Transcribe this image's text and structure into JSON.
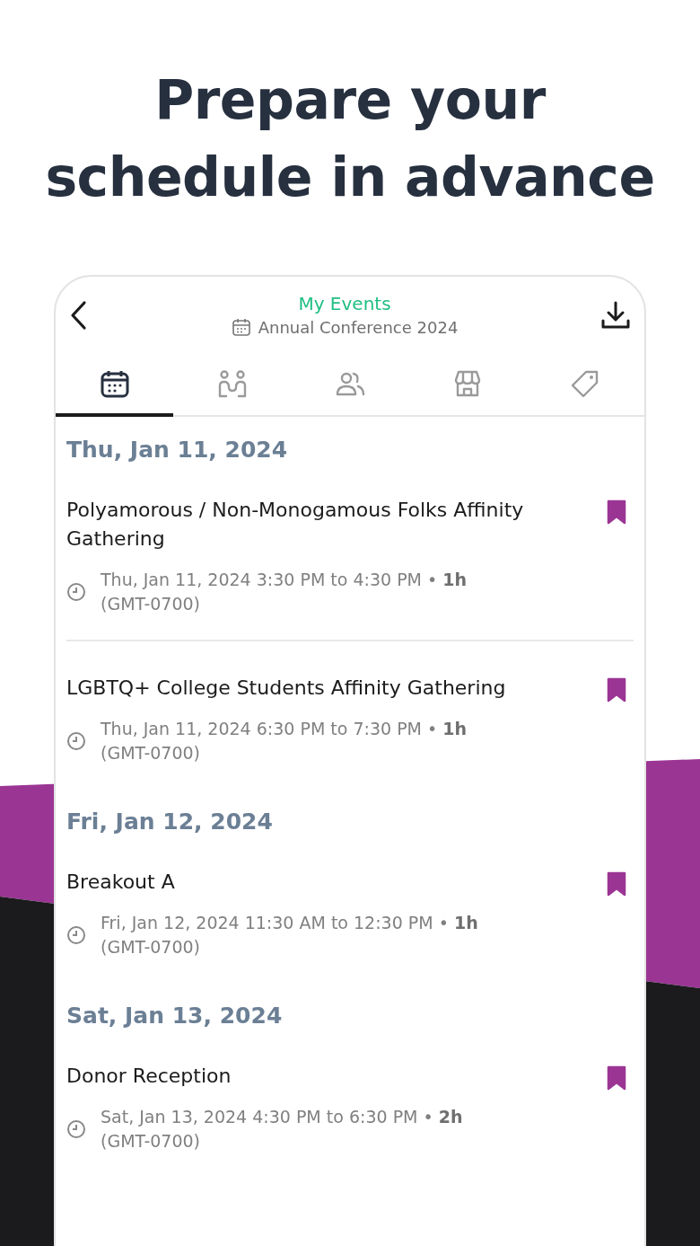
{
  "headline": "Prepare your schedule in advance",
  "header": {
    "title": "My Events",
    "subtitle": "Annual Conference 2024"
  },
  "tabs": [
    {
      "kind": "calendar",
      "selected": true
    },
    {
      "kind": "meetings",
      "selected": false
    },
    {
      "kind": "people",
      "selected": false
    },
    {
      "kind": "store",
      "selected": false
    },
    {
      "kind": "tag",
      "selected": false
    }
  ],
  "days": [
    {
      "date": "Thu, Jan 11, 2024",
      "events": [
        {
          "title": "Polyamorous / Non-Monogamous Folks Affinity Gathering",
          "time": "Thu, Jan 11, 2024 3:30 PM to 4:30 PM • **1h**",
          "timezone": "(GMT-0700)",
          "bookmarked": true
        },
        {
          "title": "LGBTQ+ College Students Affinity Gathering",
          "time": "Thu, Jan 11, 2024 6:30 PM to 7:30 PM • **1h**",
          "timezone": "(GMT-0700)",
          "bookmarked": true
        }
      ]
    },
    {
      "date": "Fri, Jan 12, 2024",
      "events": [
        {
          "title": "Breakout A",
          "time": "Fri, Jan 12, 2024 11:30 AM to 12:30 PM • **1h**",
          "timezone": "(GMT-0700)",
          "bookmarked": true
        }
      ]
    },
    {
      "date": "Sat, Jan 13, 2024",
      "events": [
        {
          "title": "Donor Reception",
          "time": "Sat, Jan 13, 2024 4:30 PM to 6:30 PM • **2h**",
          "timezone": "(GMT-0700)",
          "bookmarked": true
        }
      ]
    }
  ]
}
